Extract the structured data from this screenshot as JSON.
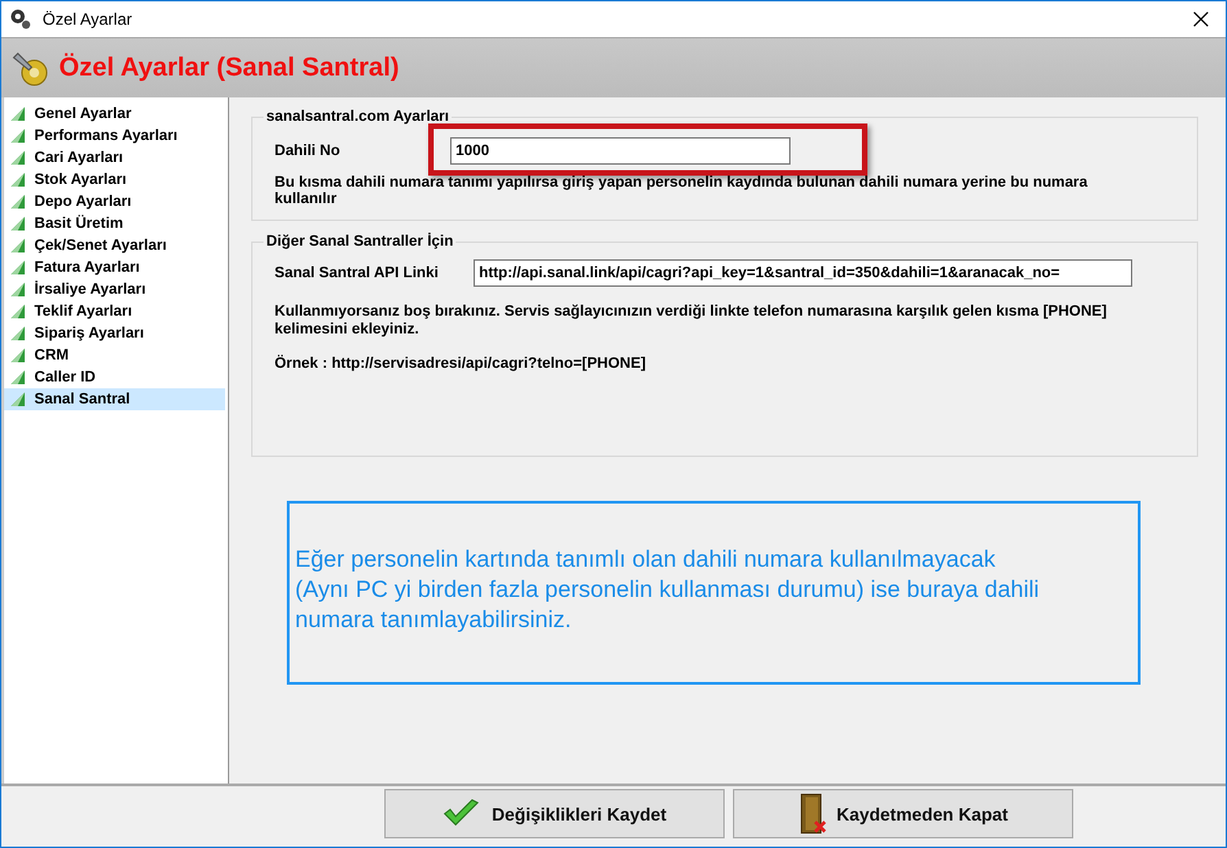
{
  "window": {
    "title": "Özel Ayarlar"
  },
  "header": {
    "title": "Özel Ayarlar (Sanal Santral)"
  },
  "sidebar": {
    "items": [
      {
        "label": "Genel Ayarlar",
        "selected": false
      },
      {
        "label": "Performans Ayarları",
        "selected": false
      },
      {
        "label": "Cari Ayarları",
        "selected": false
      },
      {
        "label": "Stok Ayarları",
        "selected": false
      },
      {
        "label": "Depo Ayarları",
        "selected": false
      },
      {
        "label": "Basit Üretim",
        "selected": false
      },
      {
        "label": "Çek/Senet Ayarları",
        "selected": false
      },
      {
        "label": "Fatura Ayarları",
        "selected": false
      },
      {
        "label": "İrsaliye Ayarları",
        "selected": false
      },
      {
        "label": "Teklif Ayarları",
        "selected": false
      },
      {
        "label": "Sipariş Ayarları",
        "selected": false
      },
      {
        "label": "CRM",
        "selected": false
      },
      {
        "label": "Caller ID",
        "selected": false
      },
      {
        "label": "Sanal Santral",
        "selected": true
      }
    ]
  },
  "group_1": {
    "legend": "sanalsantral.com Ayarları",
    "field_label": "Dahili No",
    "field_value": "1000",
    "help": "Bu kısma dahili numara tanımı yapılırsa giriş yapan personelin kaydında bulunan dahili numara yerine bu numara kullanılır"
  },
  "group_2": {
    "legend": "Diğer Sanal Santraller İçin",
    "field_label": "Sanal Santral API  Linki",
    "field_value": "http://api.sanal.link/api/cagri?api_key=1&santral_id=350&dahili=1&aranacak_no=",
    "help": "Kullanmıyorsanız boş bırakınız. Servis sağlayıcınızın verdiği linkte telefon numarasına karşılık gelen kısma [PHONE] kelimesini ekleyiniz.",
    "example": "Örnek : http://servisadresi/api/cagri?telno=[PHONE]"
  },
  "note": "Eğer personelin kartında tanımlı olan dahili numara kullanılmayacak (Aynı PC yi birden fazla personelin kullanması durumu) ise buraya dahili numara tanımlayabilirsiniz.",
  "buttons": [
    {
      "kind": "save",
      "label": "Değişiklikleri Kaydet"
    },
    {
      "kind": "close",
      "label": "Kaydetmeden Kapat"
    }
  ]
}
